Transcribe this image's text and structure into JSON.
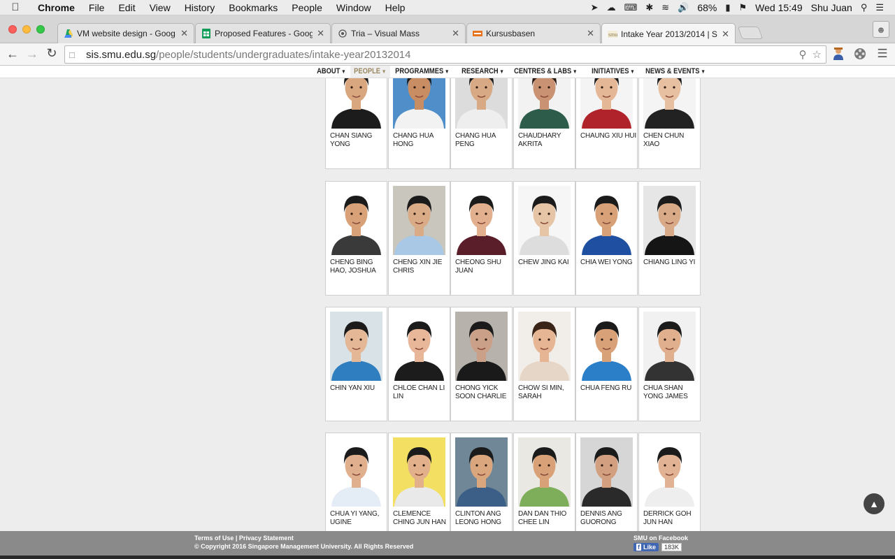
{
  "menubar": {
    "app": "Chrome",
    "items": [
      "File",
      "Edit",
      "View",
      "History",
      "Bookmarks",
      "People",
      "Window",
      "Help"
    ],
    "battery": "68%",
    "clock": "Wed 15:49",
    "user": "Shu Juan"
  },
  "tabs": [
    {
      "title": "VM website design - Goog",
      "icon": "drive-icon",
      "color": "#1fa463"
    },
    {
      "title": "Proposed Features - Goog",
      "icon": "sheets-icon",
      "color": "#0f9d58"
    },
    {
      "title": "Tria – Visual Mass",
      "icon": "tria-icon",
      "color": "#555555"
    },
    {
      "title": "Kursusbasen",
      "icon": "kursus-icon",
      "color": "#e8731a"
    },
    {
      "title": "Intake Year 2013/2014 | S",
      "icon": "smu-icon",
      "color": "#8a7a50"
    }
  ],
  "address": {
    "host": "sis.smu.edu.sg",
    "path": "/people/students/undergraduates/intake-year20132014"
  },
  "sitenav": [
    "ABOUT",
    "PEOPLE",
    "PROGRAMMES",
    "RESEARCH",
    "CENTRES & LABS",
    "INITIATIVES",
    "NEWS & EVENTS"
  ],
  "sitenav_active": "PEOPLE",
  "rows": [
    [
      {
        "name": "CHAN SIANG YONG",
        "bg": "#ffffff",
        "skin": "#d9a77f",
        "hair": "#1b1b1b",
        "shirt": "#1c1c1c"
      },
      {
        "name": "CHANG HUA HONG",
        "bg": "#4f8ec9",
        "skin": "#c98d63",
        "hair": "#1b1b1b",
        "shirt": "#f2f2f2"
      },
      {
        "name": "CHANG HUA PENG",
        "bg": "#dcdcdc",
        "skin": "#d7a985",
        "hair": "#1b1b1b",
        "shirt": "#eeeeee"
      },
      {
        "name": "CHAUDHARY AKRITA",
        "bg": "#f2f2f2",
        "skin": "#c99272",
        "hair": "#2a1a12",
        "shirt": "#2d5d4a"
      },
      {
        "name": "CHAUNG XIU HUI",
        "bg": "#f4f4f4",
        "skin": "#e4b896",
        "hair": "#1b1b1b",
        "shirt": "#b0232a"
      },
      {
        "name": "CHEN CHUN XIAO",
        "bg": "#f4f4f4",
        "skin": "#e6c0a0",
        "hair": "#1b1b1b",
        "shirt": "#222222"
      }
    ],
    [
      {
        "name": "CHENG BING HAO, JOSHUA",
        "bg": "#ffffff",
        "skin": "#d9a178",
        "hair": "#1b1b1b",
        "shirt": "#3a3a3a"
      },
      {
        "name": "CHENG XIN JIE CHRIS",
        "bg": "#c8c6bd",
        "skin": "#d9ab86",
        "hair": "#1b1b1b",
        "shirt": "#a9c8e6"
      },
      {
        "name": "CHEONG SHU JUAN",
        "bg": "#ffffff",
        "skin": "#e2b08e",
        "hair": "#1b1b1b",
        "shirt": "#5a1e2a"
      },
      {
        "name": "CHEW JING KAI",
        "bg": "#f6f6f6",
        "skin": "#e6c4a6",
        "hair": "#1b1b1b",
        "shirt": "#dddddd"
      },
      {
        "name": "CHIA WEI YONG",
        "bg": "#ffffff",
        "skin": "#d9a178",
        "hair": "#1b1b1b",
        "shirt": "#1f4fa0"
      },
      {
        "name": "CHIANG LING YI",
        "bg": "#e6e6e6",
        "skin": "#d9aa88",
        "hair": "#1b1b1b",
        "shirt": "#151515"
      }
    ],
    [
      {
        "name": "CHIN YAN XIU",
        "bg": "#d9e2e6",
        "skin": "#e4b896",
        "hair": "#1b1b1b",
        "shirt": "#2f7fc0"
      },
      {
        "name": "CHLOE CHAN LI LIN",
        "bg": "#ffffff",
        "skin": "#e8b79a",
        "hair": "#1b1b1b",
        "shirt": "#1c1c1c"
      },
      {
        "name": "CHONG YICK SOON CHARLIE",
        "bg": "#b8b2ad",
        "skin": "#caa088",
        "hair": "#1b1b1b",
        "shirt": "#1a1a1a"
      },
      {
        "name": "CHOW SI MIN, SARAH",
        "bg": "#f1eee9",
        "skin": "#e6b594",
        "hair": "#3a2418",
        "shirt": "#e6d6c8"
      },
      {
        "name": "CHUA FENG RU",
        "bg": "#ffffff",
        "skin": "#d9a178",
        "hair": "#1b1b1b",
        "shirt": "#2a7fc8"
      },
      {
        "name": "CHUA SHAN YONG JAMES",
        "bg": "#f1f1f1",
        "skin": "#e0b08e",
        "hair": "#1b1b1b",
        "shirt": "#333333"
      }
    ],
    [
      {
        "name": "CHUA YI YANG, UGINE",
        "bg": "#ffffff",
        "skin": "#e0b08e",
        "hair": "#1b1b1b",
        "shirt": "#e4ecf6"
      },
      {
        "name": "CLEMENCE CHING JUN HAN",
        "bg": "#f3df62",
        "skin": "#e2b08a",
        "hair": "#1b1b1b",
        "shirt": "#e9e9e9"
      },
      {
        "name": "CLINTON ANG LEONG HONG",
        "bg": "#6f8796",
        "skin": "#d9a67e",
        "hair": "#1b1b1b",
        "shirt": "#3b5f86"
      },
      {
        "name": "DAN DAN THIO CHEE LIN",
        "bg": "#eae8e2",
        "skin": "#d9a178",
        "hair": "#1b1b1b",
        "shirt": "#7fae5a"
      },
      {
        "name": "DENNIS ANG GUORONG",
        "bg": "#d6d6d6",
        "skin": "#d2a080",
        "hair": "#1b1b1b",
        "shirt": "#2a2a2a"
      },
      {
        "name": "DERRICK GOH JUN HAN",
        "bg": "#ffffff",
        "skin": "#e2b294",
        "hair": "#1b1b1b",
        "shirt": "#eeeeee"
      }
    ]
  ],
  "footer": {
    "links": "Terms of Use | Privacy Statement",
    "copyright": "© Copyright 2016 Singapore Management University. All Rights Reserved",
    "facebook": "SMU on Facebook",
    "like": "Like",
    "like_count": "183K"
  }
}
